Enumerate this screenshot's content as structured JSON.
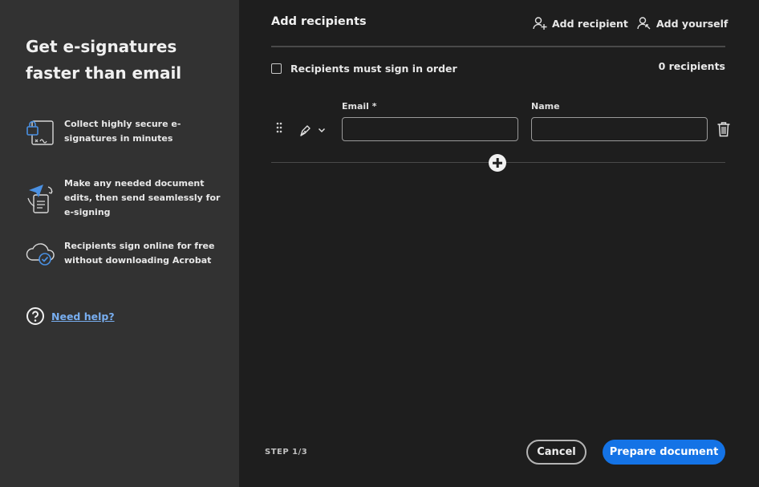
{
  "left_panel": {
    "heading": "Get e-signatures faster than email",
    "features": [
      {
        "icon": "secure-document-icon",
        "text": "Collect highly secure e-signatures in minutes"
      },
      {
        "icon": "send-document-icon",
        "text": "Make any needed document edits, then send seamlessly for e-signing"
      },
      {
        "icon": "cloud-check-icon",
        "text": "Recipients sign online for free without downloading Acrobat"
      }
    ],
    "help_link": "Need help?"
  },
  "main": {
    "title": "Add recipients",
    "add_recipient_label": "Add recipient",
    "add_yourself_label": "Add yourself",
    "sign_in_order_label": "Recipients must sign in order",
    "sign_in_order_checked": false,
    "recipient_count": "0 recipients",
    "email_label": "Email *",
    "name_label": "Name",
    "email_value": "",
    "name_value": ""
  },
  "footer": {
    "step": "STEP 1/3",
    "cancel_label": "Cancel",
    "prepare_label": "Prepare document"
  },
  "colors": {
    "left_bg": "#323232",
    "main_bg": "#1e1e1e",
    "primary": "#1473e6",
    "link": "#78aef0"
  }
}
